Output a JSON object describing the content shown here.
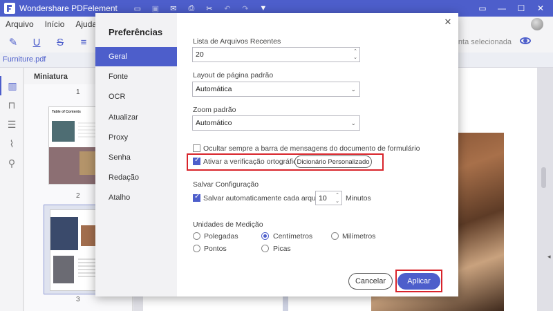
{
  "app": {
    "title": "Wondershare PDFelement",
    "accent_color": "#4d5ecb",
    "highlight_color": "#d8232a"
  },
  "titlebar_icons": [
    "folder-icon",
    "save-icon",
    "mail-icon",
    "print-icon",
    "scissors-icon",
    "undo-icon",
    "redo-icon",
    "dropdown-icon"
  ],
  "menu": [
    "Arquivo",
    "Início",
    "Ajuda"
  ],
  "toolbar": {
    "selection_text": "menta selecionada"
  },
  "file_tab": "Furniture.pdf",
  "thumbnails": {
    "header": "Miniatura",
    "page1_title": "Table of Contents",
    "pages": [
      "1",
      "2",
      "3"
    ]
  },
  "dialog": {
    "title": "Preferências",
    "nav": [
      "Geral",
      "Fonte",
      "OCR",
      "Atualizar",
      "Proxy",
      "Senha",
      "Redação",
      "Atalho"
    ],
    "recent_files": {
      "label": "Lista de Arquivos Recentes",
      "value": "20"
    },
    "page_layout": {
      "label": "Layout de página padrão",
      "value": "Automática"
    },
    "zoom": {
      "label": "Zoom padrão",
      "value": "Automático"
    },
    "hide_form_bar": {
      "label": "Ocultar sempre a barra de mensagens do documento de formulário",
      "checked": false
    },
    "spell_check": {
      "label": "Ativar a verificação ortográfica",
      "checked": true,
      "dictionary_button": "Dicionário Personalizado"
    },
    "save_config": {
      "label": "Salvar Configuração",
      "autosave_label": "Salvar automaticamente cada arquivo",
      "autosave_checked": true,
      "minutes_value": "10",
      "minutes_label": "Minutos"
    },
    "units": {
      "label": "Unidades de Medição",
      "options": [
        "Polegadas",
        "Centímetros",
        "Milímetros",
        "Pontos",
        "Picas"
      ],
      "selected": "Centímetros"
    },
    "cancel_label": "Cancelar",
    "apply_label": "Aplicar"
  }
}
